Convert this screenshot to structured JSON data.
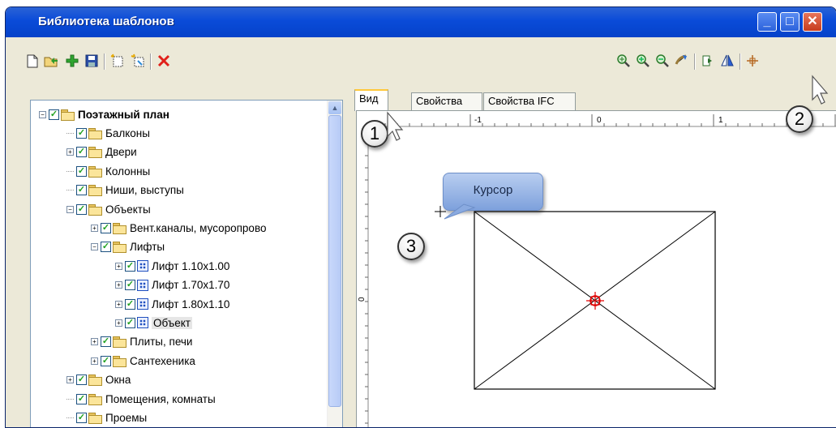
{
  "window": {
    "title": "Библиотека шаблонов",
    "colors": {
      "titlebar": "#0a4bd8",
      "accent": "#ffc83c"
    }
  },
  "toolbar_left": [
    "new-icon",
    "open-icon",
    "add-icon",
    "save-icon",
    "new-from-selection-icon",
    "update-icon",
    "delete-icon"
  ],
  "toolbar_right": [
    "zoom-extents-icon",
    "zoom-in-icon",
    "zoom-out-icon",
    "pan-icon",
    "rotate-icon",
    "mirror-icon",
    "set-cursor-icon"
  ],
  "tree": {
    "items": [
      {
        "label": "Поэтажный план",
        "level": 0,
        "expander": "−",
        "kind": "folder",
        "bold": true
      },
      {
        "label": "Балконы",
        "level": 1,
        "expander": "",
        "kind": "folder"
      },
      {
        "label": "Двери",
        "level": 1,
        "expander": "+",
        "kind": "folder"
      },
      {
        "label": "Колонны",
        "level": 1,
        "expander": "",
        "kind": "folder"
      },
      {
        "label": "Ниши, выступы",
        "level": 1,
        "expander": "",
        "kind": "folder"
      },
      {
        "label": "Объекты",
        "level": 1,
        "expander": "−",
        "kind": "folder"
      },
      {
        "label": "Вент.каналы, мусоропрово",
        "level": 2,
        "expander": "+",
        "kind": "folder"
      },
      {
        "label": "Лифты",
        "level": 2,
        "expander": "−",
        "kind": "folder"
      },
      {
        "label": "Лифт 1.10x1.00",
        "level": 3,
        "expander": "+",
        "kind": "object"
      },
      {
        "label": "Лифт 1.70x1.70",
        "level": 3,
        "expander": "+",
        "kind": "object"
      },
      {
        "label": "Лифт 1.80x1.10",
        "level": 3,
        "expander": "+",
        "kind": "object"
      },
      {
        "label": "Объект",
        "level": 3,
        "expander": "+",
        "kind": "object",
        "selected": true
      },
      {
        "label": "Плиты, печи",
        "level": 2,
        "expander": "+",
        "kind": "folder"
      },
      {
        "label": "Сантехеника",
        "level": 2,
        "expander": "+",
        "kind": "folder"
      },
      {
        "label": "Окна",
        "level": 1,
        "expander": "+",
        "kind": "folder"
      },
      {
        "label": "Помещения, комнаты",
        "level": 1,
        "expander": "",
        "kind": "folder"
      },
      {
        "label": "Проемы",
        "level": 1,
        "expander": "",
        "kind": "folder"
      }
    ]
  },
  "tabs": [
    {
      "label": "Вид",
      "active": true
    },
    {
      "label": "Свойства",
      "active": false
    },
    {
      "label": "Свойства IFC",
      "active": false
    }
  ],
  "ruler": {
    "top_labels": [
      "-1",
      "0",
      "1"
    ],
    "left_labels": [
      "0"
    ]
  },
  "annotations": {
    "callout": "Курсор",
    "badges": [
      "1",
      "2",
      "3"
    ]
  }
}
